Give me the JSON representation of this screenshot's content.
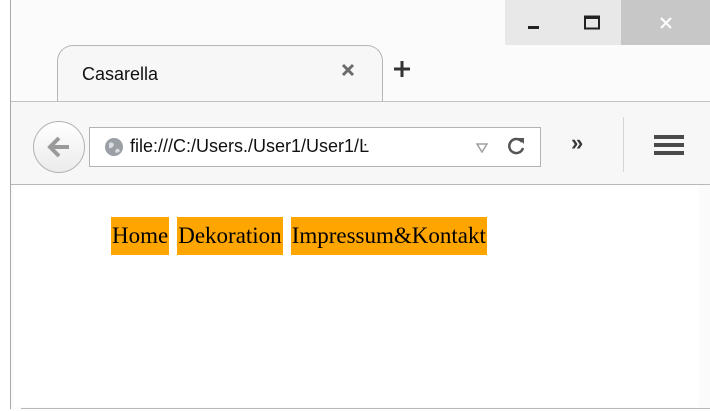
{
  "window": {
    "minimize_icon": "minimize-icon",
    "maximize_icon": "maximize-icon",
    "close_icon": "close-icon"
  },
  "tab": {
    "title": "Casarella",
    "close_icon": "close-icon",
    "new_tab_icon": "plus-icon"
  },
  "navbar": {
    "back_icon": "arrow-left-icon",
    "site_icon": "globe-icon",
    "url": "file:///C:/Users./User1/User1/",
    "url_cut_glyph": "Ŀ",
    "dropdown_icon": "triangle-down-icon",
    "reload_icon": "reload-icon",
    "overflow_label": "»",
    "menu_icon": "hamburger-icon"
  },
  "page": {
    "nav_items": [
      "Home",
      "Dekoration",
      "Impressum&Kontakt"
    ],
    "nav_bg": "#ffa500"
  }
}
